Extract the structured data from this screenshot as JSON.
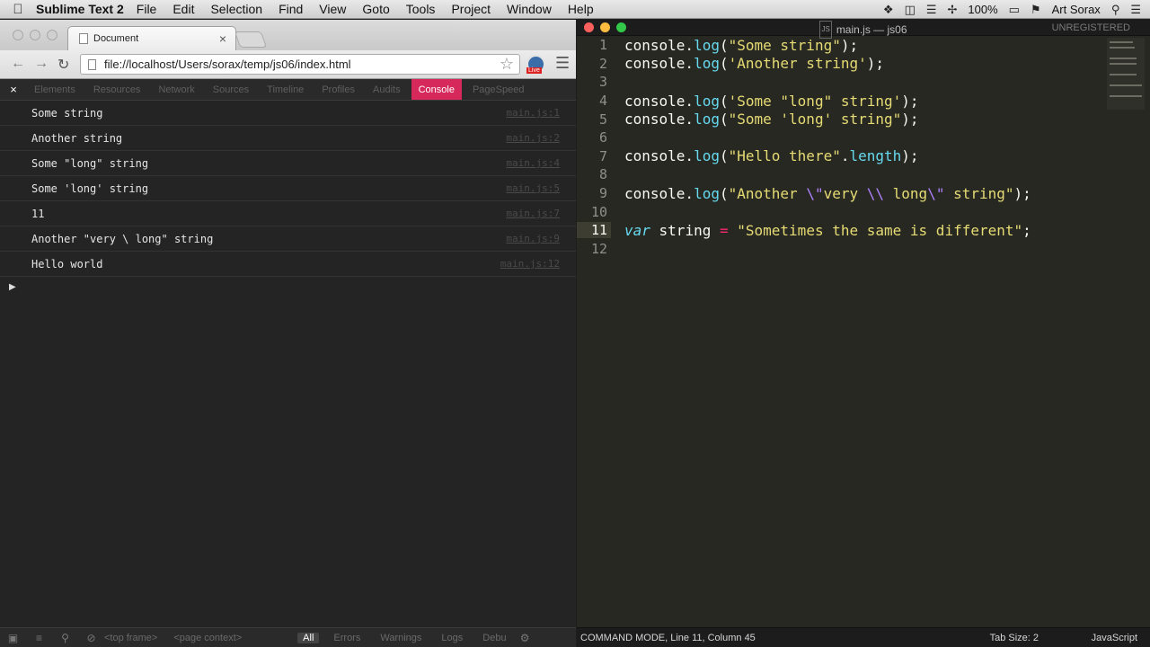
{
  "menubar": {
    "app_name": "Sublime Text 2",
    "items": [
      "File",
      "Edit",
      "Selection",
      "Find",
      "View",
      "Goto",
      "Tools",
      "Project",
      "Window",
      "Help"
    ],
    "battery": "100%",
    "user": "Art Sorax"
  },
  "browser": {
    "tab_title": "Document",
    "tab_close": "×",
    "url": "file://localhost/Users/sorax/temp/js06/index.html",
    "live_badge": "Live"
  },
  "devtools": {
    "close": "×",
    "tabs": [
      "Elements",
      "Resources",
      "Network",
      "Sources",
      "Timeline",
      "Profiles",
      "Audits",
      "Console",
      "PageSpeed"
    ],
    "active_tab": "Console",
    "logs": [
      {
        "text": "Some string",
        "source": "main.js:1"
      },
      {
        "text": "Another string",
        "source": "main.js:2"
      },
      {
        "text": "Some \"long\" string",
        "source": "main.js:4"
      },
      {
        "text": "Some 'long' string",
        "source": "main.js:5"
      },
      {
        "text": "11",
        "source": "main.js:7"
      },
      {
        "text": "Another \"very \\ long\" string",
        "source": "main.js:9"
      },
      {
        "text": "Hello world",
        "source": "main.js:12"
      }
    ],
    "bottom": {
      "frame": "<top frame>",
      "context": "<page context>",
      "filters": [
        "All",
        "Errors",
        "Warnings",
        "Logs",
        "Debu"
      ],
      "active_filter": "All"
    }
  },
  "editor": {
    "title": "main.js — js06",
    "unregistered": "UNREGISTERED",
    "current_line": 11,
    "lines": [
      {
        "n": "1",
        "tokens": [
          [
            "",
            "console."
          ],
          [
            "fn",
            "log"
          ],
          [
            "",
            "("
          ],
          [
            "str",
            "\"Some string\""
          ],
          [
            "",
            ");"
          ]
        ]
      },
      {
        "n": "2",
        "tokens": [
          [
            "",
            "console."
          ],
          [
            "fn",
            "log"
          ],
          [
            "",
            "("
          ],
          [
            "str",
            "'Another string'"
          ],
          [
            "",
            ");"
          ]
        ]
      },
      {
        "n": "3",
        "tokens": []
      },
      {
        "n": "4",
        "tokens": [
          [
            "",
            "console."
          ],
          [
            "fn",
            "log"
          ],
          [
            "",
            "("
          ],
          [
            "str",
            "'Some \"long\" string'"
          ],
          [
            "",
            ");"
          ]
        ]
      },
      {
        "n": "5",
        "tokens": [
          [
            "",
            "console."
          ],
          [
            "fn",
            "log"
          ],
          [
            "",
            "("
          ],
          [
            "str",
            "\"Some 'long' string\""
          ],
          [
            "",
            ");"
          ]
        ]
      },
      {
        "n": "6",
        "tokens": []
      },
      {
        "n": "7",
        "tokens": [
          [
            "",
            "console."
          ],
          [
            "fn",
            "log"
          ],
          [
            "",
            "("
          ],
          [
            "str",
            "\"Hello there\""
          ],
          [
            "",
            "."
          ],
          [
            "fn",
            "length"
          ],
          [
            "",
            ");"
          ]
        ]
      },
      {
        "n": "8",
        "tokens": []
      },
      {
        "n": "9",
        "tokens": [
          [
            "",
            "console."
          ],
          [
            "fn",
            "log"
          ],
          [
            "",
            "("
          ],
          [
            "str",
            "\"Another "
          ],
          [
            "esc",
            "\\\""
          ],
          [
            "str",
            "very "
          ],
          [
            "esc",
            "\\\\"
          ],
          [
            "str",
            " long"
          ],
          [
            "esc",
            "\\\""
          ],
          [
            "str",
            " string\""
          ],
          [
            "",
            ");"
          ]
        ]
      },
      {
        "n": "10",
        "tokens": []
      },
      {
        "n": "11",
        "tokens": [
          [
            "kw",
            "var"
          ],
          [
            "",
            " string "
          ],
          [
            "op",
            "="
          ],
          [
            "",
            " "
          ],
          [
            "str",
            "\"Sometimes the same is different\""
          ],
          [
            "",
            ";"
          ]
        ]
      },
      {
        "n": "12",
        "tokens": []
      }
    ],
    "status": {
      "mode": "COMMAND MODE, Line 11, Column 45",
      "tab_size": "Tab Size: 2",
      "syntax": "JavaScript"
    }
  },
  "colors": {
    "devtools_active_tab": "#d6285a",
    "editor_bg": "#272822",
    "string": "#e6db74",
    "function": "#66d9ef",
    "escape": "#ae81ff",
    "operator": "#f92672"
  }
}
